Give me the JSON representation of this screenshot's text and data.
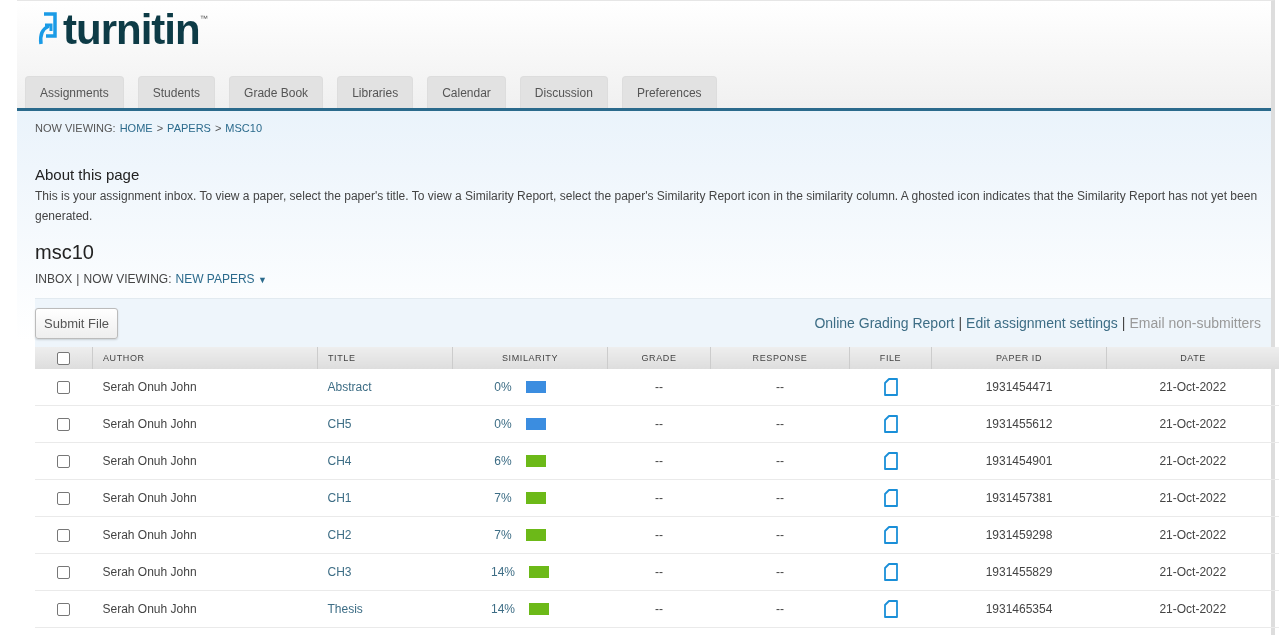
{
  "logo": {
    "text": "turnitin",
    "mark": "™"
  },
  "tabs": [
    {
      "label": "Assignments"
    },
    {
      "label": "Students"
    },
    {
      "label": "Grade Book"
    },
    {
      "label": "Libraries"
    },
    {
      "label": "Calendar"
    },
    {
      "label": "Discussion"
    },
    {
      "label": "Preferences"
    }
  ],
  "breadcrumb": {
    "prefix": "NOW VIEWING:",
    "items": [
      "HOME",
      "PAPERS",
      "MSC10"
    ],
    "separator": ">"
  },
  "about": {
    "heading": "About this page",
    "text": "This is your assignment inbox. To view a paper, select the paper's title. To view a Similarity Report, select the paper's Similarity Report icon in the similarity column. A ghosted icon indicates that the Similarity Report has not yet been generated."
  },
  "assignment": {
    "title": "msc10",
    "inbox": "INBOX",
    "separator": "|",
    "viewing_label": "NOW VIEWING:",
    "viewing_value": "NEW PAPERS",
    "caret": "▼"
  },
  "toolbar": {
    "button": "Submit File",
    "links": [
      {
        "label": "Online Grading Report",
        "disabled": false
      },
      {
        "label": "Edit assignment settings",
        "disabled": false
      },
      {
        "label": "Email non-submitters",
        "disabled": true
      }
    ],
    "separator": "|"
  },
  "table": {
    "select_all": {
      "checked": false
    },
    "columns": [
      "AUTHOR",
      "TITLE",
      "SIMILARITY",
      "GRADE",
      "RESPONSE",
      "FILE",
      "PAPER ID",
      "DATE"
    ],
    "rows": [
      {
        "checked": false,
        "author": "Serah Onuh John",
        "title": "Abstract",
        "similarity": "0%",
        "color": "#3b8de0",
        "grade": "--",
        "response": "--",
        "paper_id": "1931454471",
        "date": "21-Oct-2022"
      },
      {
        "checked": false,
        "author": "Serah Onuh John",
        "title": "CH5",
        "similarity": "0%",
        "color": "#3b8de0",
        "grade": "--",
        "response": "--",
        "paper_id": "1931455612",
        "date": "21-Oct-2022"
      },
      {
        "checked": false,
        "author": "Serah Onuh John",
        "title": "CH4",
        "similarity": "6%",
        "color": "#6cb918",
        "grade": "--",
        "response": "--",
        "paper_id": "1931454901",
        "date": "21-Oct-2022"
      },
      {
        "checked": false,
        "author": "Serah Onuh John",
        "title": "CH1",
        "similarity": "7%",
        "color": "#6cb918",
        "grade": "--",
        "response": "--",
        "paper_id": "1931457381",
        "date": "21-Oct-2022"
      },
      {
        "checked": false,
        "author": "Serah Onuh John",
        "title": "CH2",
        "similarity": "7%",
        "color": "#6cb918",
        "grade": "--",
        "response": "--",
        "paper_id": "1931459298",
        "date": "21-Oct-2022"
      },
      {
        "checked": false,
        "author": "Serah Onuh John",
        "title": "CH3",
        "similarity": "14%",
        "color": "#6cb918",
        "grade": "--",
        "response": "--",
        "paper_id": "1931455829",
        "date": "21-Oct-2022"
      },
      {
        "checked": false,
        "author": "Serah Onuh John",
        "title": "Thesis",
        "similarity": "14%",
        "color": "#6cb918",
        "grade": "--",
        "response": "--",
        "paper_id": "1931465354",
        "date": "21-Oct-2022"
      }
    ]
  }
}
